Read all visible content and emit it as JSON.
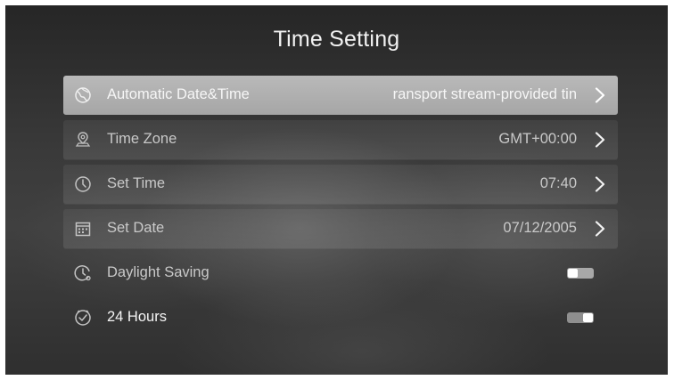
{
  "header": {
    "title": "Time Setting"
  },
  "rows": [
    {
      "label": "Automatic Date&Time",
      "value": "ransport stream-provided tin",
      "icon": "globe-icon",
      "selected": true
    },
    {
      "label": "Time Zone",
      "value": "GMT+00:00",
      "icon": "location-pin-icon"
    },
    {
      "label": "Set Time",
      "value": "07:40",
      "icon": "clock-icon"
    },
    {
      "label": "Set Date",
      "value": "07/12/2005",
      "icon": "calendar-icon"
    },
    {
      "label": "Daylight Saving",
      "icon": "daylight-clock-icon",
      "toggle": "off"
    },
    {
      "label": "24 Hours",
      "icon": "clock-check-icon",
      "toggle": "on"
    }
  ],
  "colors": {
    "selected_row": "#b0b0b0",
    "text": "#c9c9c9",
    "title": "#f2f2f2"
  }
}
